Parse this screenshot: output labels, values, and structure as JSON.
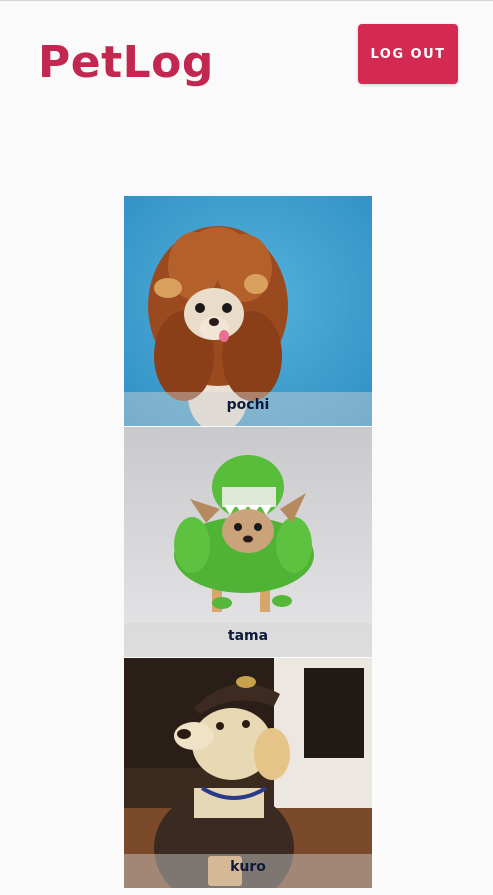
{
  "header": {
    "title": "PetLog",
    "logout_label": "LOG OUT"
  },
  "pets": [
    {
      "name": "pochi",
      "photo": "dog-in-lion-mane-costume"
    },
    {
      "name": "tama",
      "photo": "dog-in-green-dinosaur-costume"
    },
    {
      "name": "kuro",
      "photo": "dog-in-delivery-uniform-costume"
    }
  ],
  "colors": {
    "brand": "#c2284f",
    "button": "#d42a52",
    "background": "#fafafa"
  }
}
